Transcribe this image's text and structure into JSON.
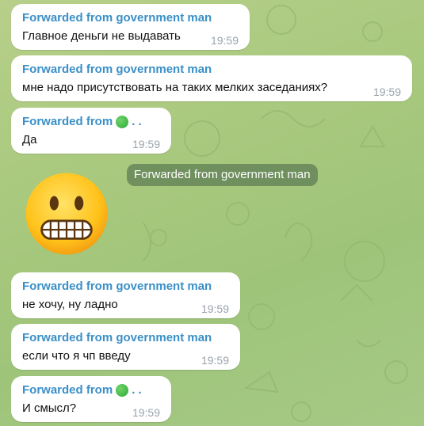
{
  "messages": [
    {
      "forward_from": "Forwarded from government man",
      "text": "Главное деньги не выдавать",
      "time": "19:59"
    },
    {
      "forward_from": "Forwarded from government man",
      "text": "мне надо присутствовать на таких мелких заседаниях?",
      "time": "19:59"
    },
    {
      "forward_from": "Forwarded from",
      "forward_suffix": ". .",
      "text": "Да",
      "time": "19:59"
    },
    {
      "forward_from": "Forwarded from government man",
      "text": "не хочу, ну ладно",
      "time": "19:59"
    },
    {
      "forward_from": "Forwarded from government man",
      "text": "если что я чп введу",
      "time": "19:59"
    },
    {
      "forward_from": "Forwarded from",
      "forward_suffix": ". .",
      "text": "И смысл?",
      "time": "19:59"
    }
  ],
  "service_message": {
    "text": "Forwarded from government man"
  },
  "sticker": {
    "icon": "grimacing-face-icon"
  },
  "colors": {
    "forward_name": "#3a8fc7",
    "bubble": "#ffffff",
    "timestamp": "#9aa3ab",
    "background": "#a9c97e"
  }
}
